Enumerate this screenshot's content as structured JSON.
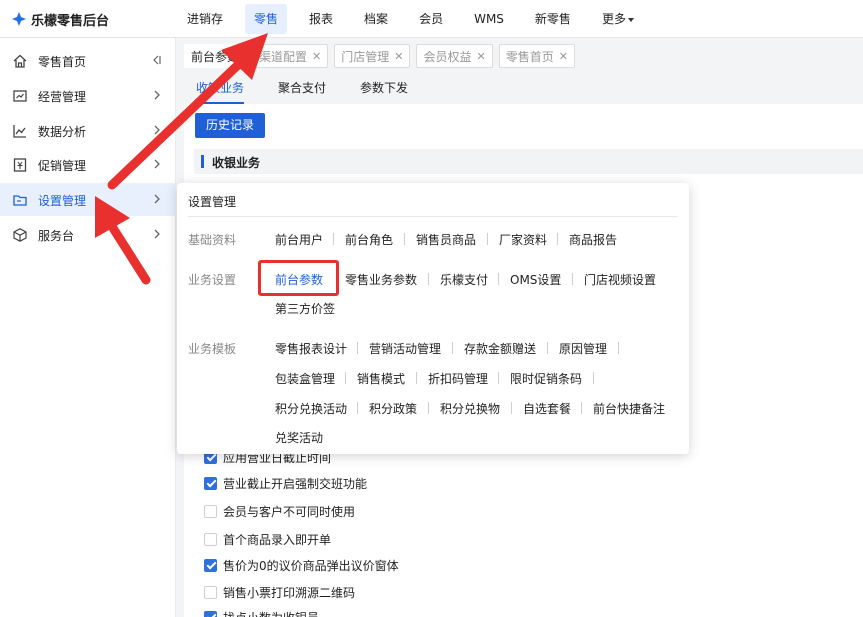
{
  "app": {
    "title": "乐檬零售后台"
  },
  "topnav": {
    "items": [
      "进销存",
      "零售",
      "报表",
      "档案",
      "会员",
      "WMS",
      "新零售",
      "更多"
    ],
    "active_index": 1
  },
  "sidebar": {
    "items": [
      {
        "label": "零售首页",
        "icon": "home-icon"
      },
      {
        "label": "经营管理",
        "icon": "chart-board-icon"
      },
      {
        "label": "数据分析",
        "icon": "line-chart-icon"
      },
      {
        "label": "促销管理",
        "icon": "promotion-icon"
      },
      {
        "label": "设置管理",
        "icon": "folder-icon"
      },
      {
        "label": "服务台",
        "icon": "cube-icon"
      }
    ],
    "active_index": 4
  },
  "tabs": [
    "前台参数",
    "渠道配置",
    "门店管理",
    "会员权益",
    "零售首页"
  ],
  "subtabs": [
    "收银业务",
    "聚合支付",
    "参数下发"
  ],
  "buttons": {
    "history": "历史记录"
  },
  "section": {
    "title": "收银业务"
  },
  "checkboxes": [
    {
      "label": "应用营业日截止时间",
      "checked": true
    },
    {
      "label": "营业截止开启强制交班功能",
      "checked": true
    },
    {
      "label": "会员与客户不可同时使用",
      "checked": false
    },
    {
      "label": "首个商品录入即开单",
      "checked": false
    },
    {
      "label": "售价为0的议价商品弹出议价窗体",
      "checked": true
    },
    {
      "label": "销售小票打印溯源二维码",
      "checked": false
    },
    {
      "label": "找点小数为收银员",
      "checked": true
    }
  ],
  "panel": {
    "title": "设置管理",
    "groups": [
      {
        "label": "基础资料",
        "links": [
          "前台用户",
          "前台角色",
          "销售员商品",
          "厂家资料",
          "商品报告"
        ]
      },
      {
        "label": "业务设置",
        "links": [
          "前台参数",
          "零售业务参数",
          "乐檬支付",
          "OMS设置",
          "门店视频设置",
          "第三方价签"
        ],
        "selected": "前台参数"
      },
      {
        "label": "业务模板",
        "links": [
          "零售报表设计",
          "营销活动管理",
          "存款金额赠送",
          "原因管理",
          "包装盒管理",
          "销售模式",
          "折扣码管理",
          "限时促销条码",
          "积分兑换活动",
          "积分政策",
          "积分兑换物",
          "自选套餐",
          "前台快捷备注",
          "兑奖活动"
        ]
      }
    ]
  },
  "colors": {
    "accent": "#1f5fd8",
    "annotation": "#e8312f"
  }
}
